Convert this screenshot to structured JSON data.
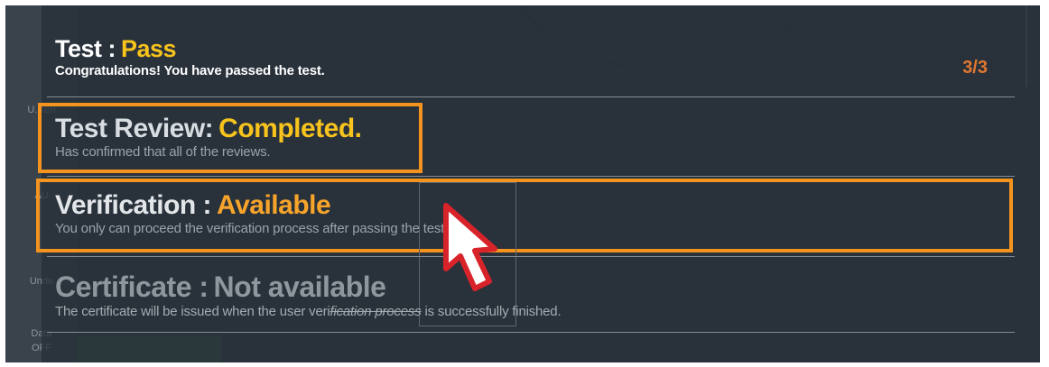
{
  "test": {
    "label": "Test :",
    "status": "Pass",
    "description": "Congratulations! You have passed the test.",
    "counter": "3/3"
  },
  "review": {
    "label": "Test Review:",
    "status": "Completed.",
    "description": "Has confirmed that all of the reviews."
  },
  "verification": {
    "label": "Verification :",
    "status": "Available",
    "description": "You only can proceed the verification process after passing the test."
  },
  "certificate": {
    "label": "Certificate :",
    "status": "Not available",
    "description_before": "The certificate will be issued when the user veri",
    "description_struck": "fication process",
    "description_after": " is successfully finished."
  },
  "background_sidebar": {
    "items": [
      "U.Ren",
      "AU",
      "Unde",
      "Data",
      "OFF"
    ]
  },
  "colors": {
    "status_yellow": "#f7c31d",
    "status_orange": "#f7a42a",
    "highlight_border": "#f4941f",
    "counter": "#e0772f",
    "panel_bg": "#2f3a44"
  },
  "icons": {
    "cursor": "mouse-pointer-icon"
  }
}
